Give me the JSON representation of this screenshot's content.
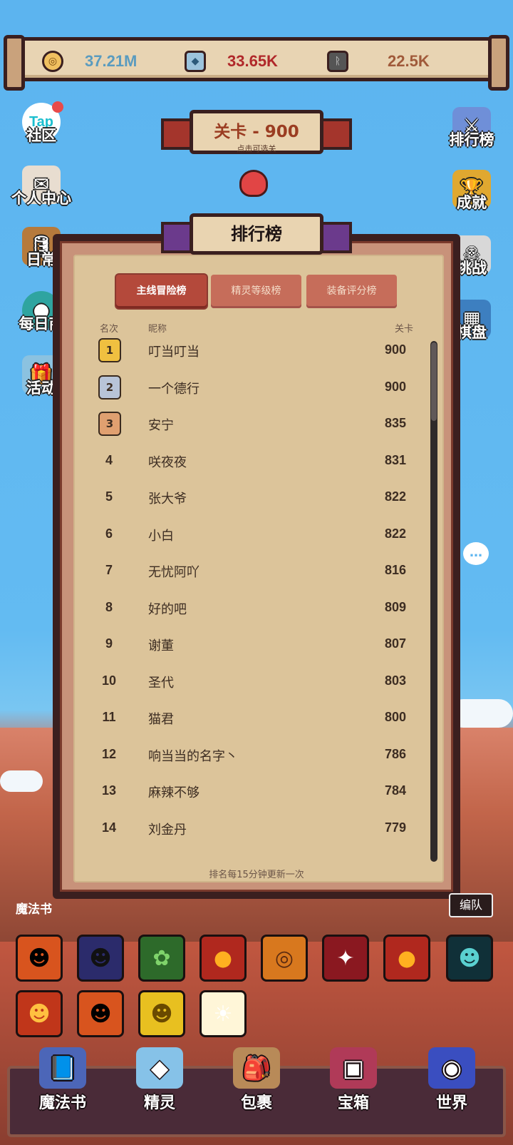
{
  "resources": [
    {
      "icon": "coin-icon",
      "value": "37.21M",
      "color": "#5a9bbf"
    },
    {
      "icon": "crystal-icon",
      "value": "33.65K",
      "color": "#b0282a"
    },
    {
      "icon": "rune-stone-icon",
      "value": "22.5K",
      "color": "#a05a3a"
    }
  ],
  "left_menu": {
    "community": "社区",
    "community_badge": "Tap",
    "profile": "个人中心",
    "daily": "日常",
    "daily_shop": "每日商",
    "events": "活动"
  },
  "right_menu": {
    "ranking": "排行榜",
    "achievements": "成就",
    "challenge": "挑战",
    "board": "棋盘"
  },
  "level": {
    "title": "关卡 - 900",
    "subtitle": "点击可选关"
  },
  "leaderboard": {
    "title": "排行榜",
    "tabs": [
      "主线冒险榜",
      "精灵等级榜",
      "装备评分榜"
    ],
    "active_tab": 0,
    "headers": {
      "rank": "名次",
      "name": "昵称",
      "score": "关卡"
    },
    "rows": [
      {
        "rank": "1",
        "name": "叮当叮当",
        "score": "900"
      },
      {
        "rank": "2",
        "name": "一个德行",
        "score": "900"
      },
      {
        "rank": "3",
        "name": "安宁",
        "score": "835"
      },
      {
        "rank": "4",
        "name": "咲夜夜",
        "score": "831"
      },
      {
        "rank": "5",
        "name": "张大爷",
        "score": "822"
      },
      {
        "rank": "6",
        "name": "小白",
        "score": "822"
      },
      {
        "rank": "7",
        "name": "无忧阿吖",
        "score": "816"
      },
      {
        "rank": "8",
        "name": "好的吧",
        "score": "809"
      },
      {
        "rank": "9",
        "name": "谢董",
        "score": "807"
      },
      {
        "rank": "10",
        "name": "圣代",
        "score": "803"
      },
      {
        "rank": "11",
        "name": "猫君",
        "score": "800"
      },
      {
        "rank": "12",
        "name": "响当当的名字丶",
        "score": "786"
      },
      {
        "rank": "13",
        "name": "麻辣不够",
        "score": "784"
      },
      {
        "rank": "14",
        "name": "刘金丹",
        "score": "779"
      }
    ],
    "footnote": "排名每15分钟更新一次"
  },
  "skill_strip": {
    "label": "魔法书",
    "team_button": "编队"
  },
  "bottom_nav": [
    "魔法书",
    "精灵",
    "包裹",
    "宝箱",
    "世界"
  ],
  "colors": {
    "sky": "#5fb6f0",
    "panel_paper": "#dcc49a",
    "tab_active": "#b4493b",
    "tab_inactive": "#c66d5a",
    "nav_bg": "#4a2b38"
  }
}
